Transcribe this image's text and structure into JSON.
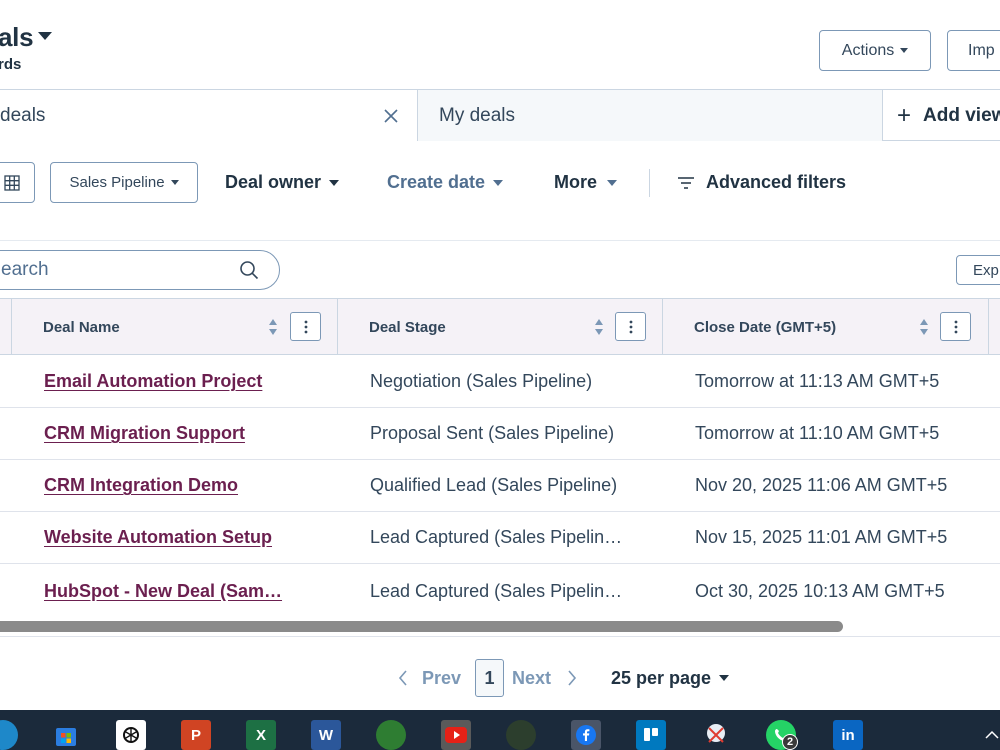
{
  "header": {
    "title": "als",
    "subtitle": "rds",
    "actions_label": "Actions",
    "import_label": "Imp"
  },
  "tabs": {
    "active_label": "deals",
    "inactive_label": "My deals",
    "add_view_label": "Add view"
  },
  "filters": {
    "pipeline_label": "Sales Pipeline",
    "deal_owner_label": "Deal owner",
    "create_date_label": "Create date",
    "more_label": "More",
    "advanced_label": "Advanced filters"
  },
  "search": {
    "placeholder": "earch",
    "export_label": "Exp"
  },
  "table": {
    "columns": [
      "Deal Name",
      "Deal Stage",
      "Close Date (GMT+5)"
    ],
    "rows": [
      {
        "name": "Email Automation Project",
        "stage": "Negotiation (Sales Pipeline)",
        "close": "Tomorrow at 11:13 AM GMT+5"
      },
      {
        "name": "CRM Migration Support",
        "stage": "Proposal Sent (Sales Pipeline)",
        "close": "Tomorrow at 11:10 AM GMT+5"
      },
      {
        "name": "CRM Integration Demo",
        "stage": "Qualified Lead (Sales Pipeline)",
        "close": "Nov 20, 2025 11:06 AM GMT+5"
      },
      {
        "name": "Website Automation Setup",
        "stage": "Lead Captured (Sales Pipelin…",
        "close": "Nov 15, 2025 11:01 AM GMT+5"
      },
      {
        "name": "HubSpot - New Deal (Sam…",
        "stage": "Lead Captured (Sales Pipelin…",
        "close": "Oct 30, 2025 10:13 AM GMT+5"
      }
    ]
  },
  "pagination": {
    "prev_label": "Prev",
    "current_page": "1",
    "next_label": "Next",
    "per_page_label": "25 per page"
  },
  "taskbar": {
    "whatsapp_badge": "2",
    "linkedin_label": "in",
    "word_label": "W",
    "excel_label": "X",
    "powerpoint_label": "P"
  },
  "colors": {
    "deal_link": "#6b1f4f",
    "header_bg": "#f5f2f7",
    "border": "#cbd6e2",
    "text": "#33475b",
    "taskbar_bg": "#1b2a3b"
  }
}
